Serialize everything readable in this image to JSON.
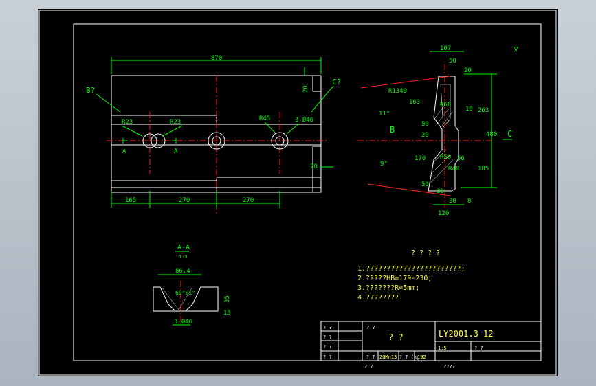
{
  "front_view": {
    "overall_length": "870",
    "section_callouts": [
      "B?",
      "C?"
    ],
    "hole_label": "3-Ø46",
    "radius_left_1": "R23",
    "radius_left_2": "R23",
    "radius_right": "R45",
    "section_mark": "A",
    "dim_top_right": "20",
    "dim_bottom_right": "20",
    "bottom_dims": [
      "165",
      "270",
      "270"
    ]
  },
  "side_view": {
    "dim_top_width": "107",
    "dim_50_top": "50",
    "dim_20_top": "20",
    "dim_r1349": "R1349",
    "dim_163": "163",
    "dim_263": "263",
    "dim_480": "480",
    "dim_185": "185",
    "dim_170": "170",
    "dim_r10": "10",
    "dim_50_a": "50",
    "dim_50_b": "50",
    "dim_20": "20",
    "dim_56": "56",
    "dim_30": "30",
    "dim_30b": "30",
    "dim_120": "120",
    "dim_8": "8",
    "angle_top": "11°",
    "angle_bottom": "9°",
    "dim_r60": "R60",
    "dim_r40": "R40",
    "dim_r50": "R50",
    "view_b": "B",
    "view_c": "C",
    "surface_symbol": "▽"
  },
  "section_aa": {
    "title": "A-A",
    "scale": "1:3",
    "width": "86.4",
    "angle": "60°±1°",
    "depth": "35",
    "depth2": "15",
    "hole": "3-Ø46"
  },
  "notes": {
    "heading": "? ? ? ?",
    "items": [
      "1.???????????????????????;",
      "2.?????HB=179-230;",
      "3.???????R=5mm;",
      "4.????????."
    ]
  },
  "title_block": {
    "drawing_number": "LY2001.3-12",
    "part_name": "? ?",
    "material": "ZGMn13",
    "scale": "1:5",
    "weight": "192",
    "sheet_label": "? ?",
    "grid_marks": [
      "? ?",
      "? ?",
      "? ?",
      "? ?",
      "? ?"
    ],
    "bottom_row": [
      "? ?",
      "? ? (kg)",
      "? ?"
    ],
    "footer_left": "?      ?",
    "footer_right": "????"
  }
}
